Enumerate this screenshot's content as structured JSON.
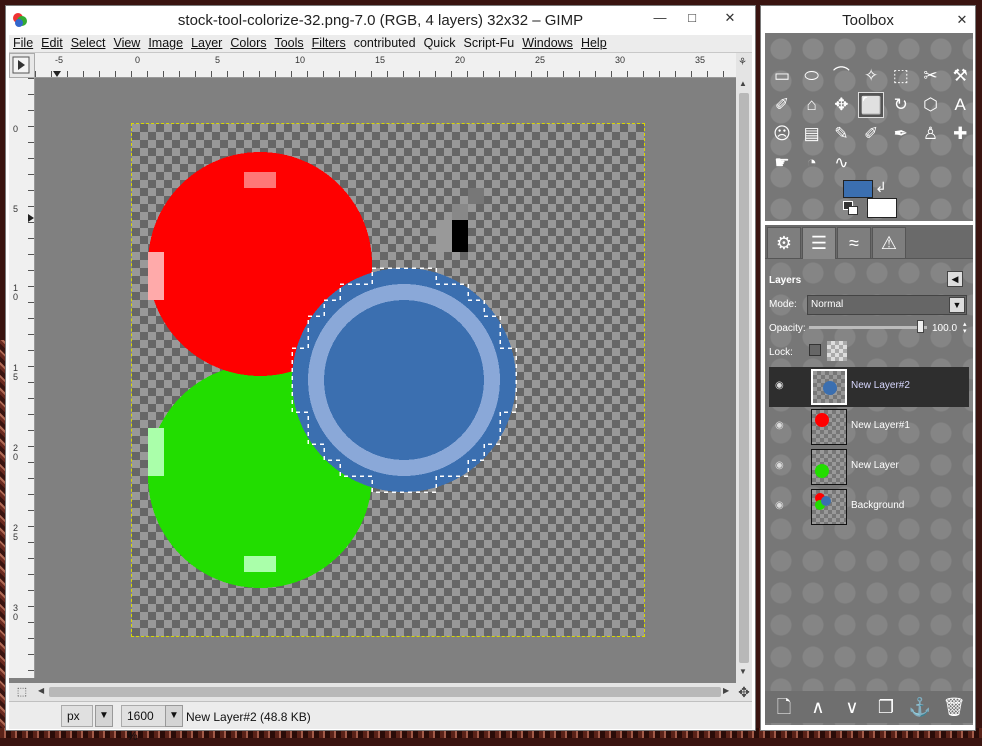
{
  "main_window": {
    "title": "stock-tool-colorize-32.png-7.0 (RGB, 4 layers) 32x32 – GIMP",
    "controls": {
      "minimize": "—",
      "maximize": "□",
      "close": "✕"
    },
    "menu": [
      "File",
      "Edit",
      "Select",
      "View",
      "Image",
      "Layer",
      "Colors",
      "Tools",
      "Filters",
      "contributed",
      "Quick",
      "Script-Fu",
      "Windows",
      "Help"
    ],
    "ruler_h_ticks": [
      "-5",
      "0",
      "5",
      "10",
      "15",
      "20",
      "25",
      "30",
      "35"
    ],
    "ruler_v_ticks": [
      "0",
      "5",
      "1\n0",
      "1\n5",
      "2\n0",
      "2\n5",
      "3\n0"
    ],
    "status": {
      "unit": "px",
      "zoom": "1600 %",
      "info": "New Layer#2 (48.8 KB)"
    }
  },
  "toolbox": {
    "title": "Toolbox",
    "close": "✕",
    "tools": [
      {
        "name": "rect-select-icon",
        "glyph": "▭"
      },
      {
        "name": "ellipse-select-icon",
        "glyph": "⬭"
      },
      {
        "name": "free-select-icon",
        "glyph": "⌒"
      },
      {
        "name": "fuzzy-select-icon",
        "glyph": "✧"
      },
      {
        "name": "select-by-color-icon",
        "glyph": "⬚"
      },
      {
        "name": "scissors-icon",
        "glyph": "✂"
      },
      {
        "name": "foreground-select-icon",
        "glyph": "⚒"
      },
      {
        "name": "paths-icon",
        "glyph": "✐"
      },
      {
        "name": "color-picker-icon",
        "glyph": "⌂"
      },
      {
        "name": "move-icon",
        "glyph": "✥"
      },
      {
        "name": "crop-icon",
        "glyph": "⬜",
        "selected": true
      },
      {
        "name": "transform-icon",
        "glyph": "↻"
      },
      {
        "name": "perspective-icon",
        "glyph": "⬡"
      },
      {
        "name": "text-icon",
        "glyph": "A"
      },
      {
        "name": "bucket-fill-icon",
        "glyph": "☹"
      },
      {
        "name": "blend-icon",
        "glyph": "▤"
      },
      {
        "name": "pencil-icon",
        "glyph": "✎"
      },
      {
        "name": "eraser-icon",
        "glyph": "✐"
      },
      {
        "name": "airbrush-icon",
        "glyph": "✒"
      },
      {
        "name": "clone-icon",
        "glyph": "♙"
      },
      {
        "name": "heal-icon",
        "glyph": "✚"
      },
      {
        "name": "smudge-icon",
        "glyph": "☛"
      },
      {
        "name": "dodge-burn-icon",
        "glyph": "◔"
      },
      {
        "name": "curves-icon",
        "glyph": "∿"
      }
    ],
    "colors": {
      "foreground": "#3b6fb0",
      "background": "#ffffff"
    }
  },
  "layers_dock": {
    "tabs": [
      "tool-options-icon",
      "layers-icon",
      "paths-icon",
      "warning-icon"
    ],
    "tab_glyphs": [
      "⚙",
      "☰",
      "≈",
      "⚠"
    ],
    "title": "Layers",
    "mode_label": "Mode:",
    "mode_value": "Normal",
    "opacity_label": "Opacity:",
    "opacity_value": "100.0",
    "lock_label": "Lock:",
    "layers": [
      {
        "name": "New Layer#2",
        "selected": true,
        "color": "#3b6fb0"
      },
      {
        "name": "New Layer#1",
        "selected": false,
        "color": "#ff0000"
      },
      {
        "name": "New Layer",
        "selected": false,
        "color": "#22dd00"
      },
      {
        "name": "Background",
        "selected": false,
        "color": "multi"
      }
    ],
    "buttons": [
      {
        "name": "new-layer-icon",
        "glyph": "🗋"
      },
      {
        "name": "raise-layer-icon",
        "glyph": "∧"
      },
      {
        "name": "lower-layer-icon",
        "glyph": "∨"
      },
      {
        "name": "duplicate-layer-icon",
        "glyph": "❐"
      },
      {
        "name": "anchor-layer-icon",
        "glyph": "⚓"
      },
      {
        "name": "delete-layer-icon",
        "glyph": "🗑"
      }
    ]
  },
  "colors": {
    "canvas_bg": "#808080",
    "red": "#ff0000",
    "green": "#22dd00",
    "blue": "#3b6fb0"
  }
}
